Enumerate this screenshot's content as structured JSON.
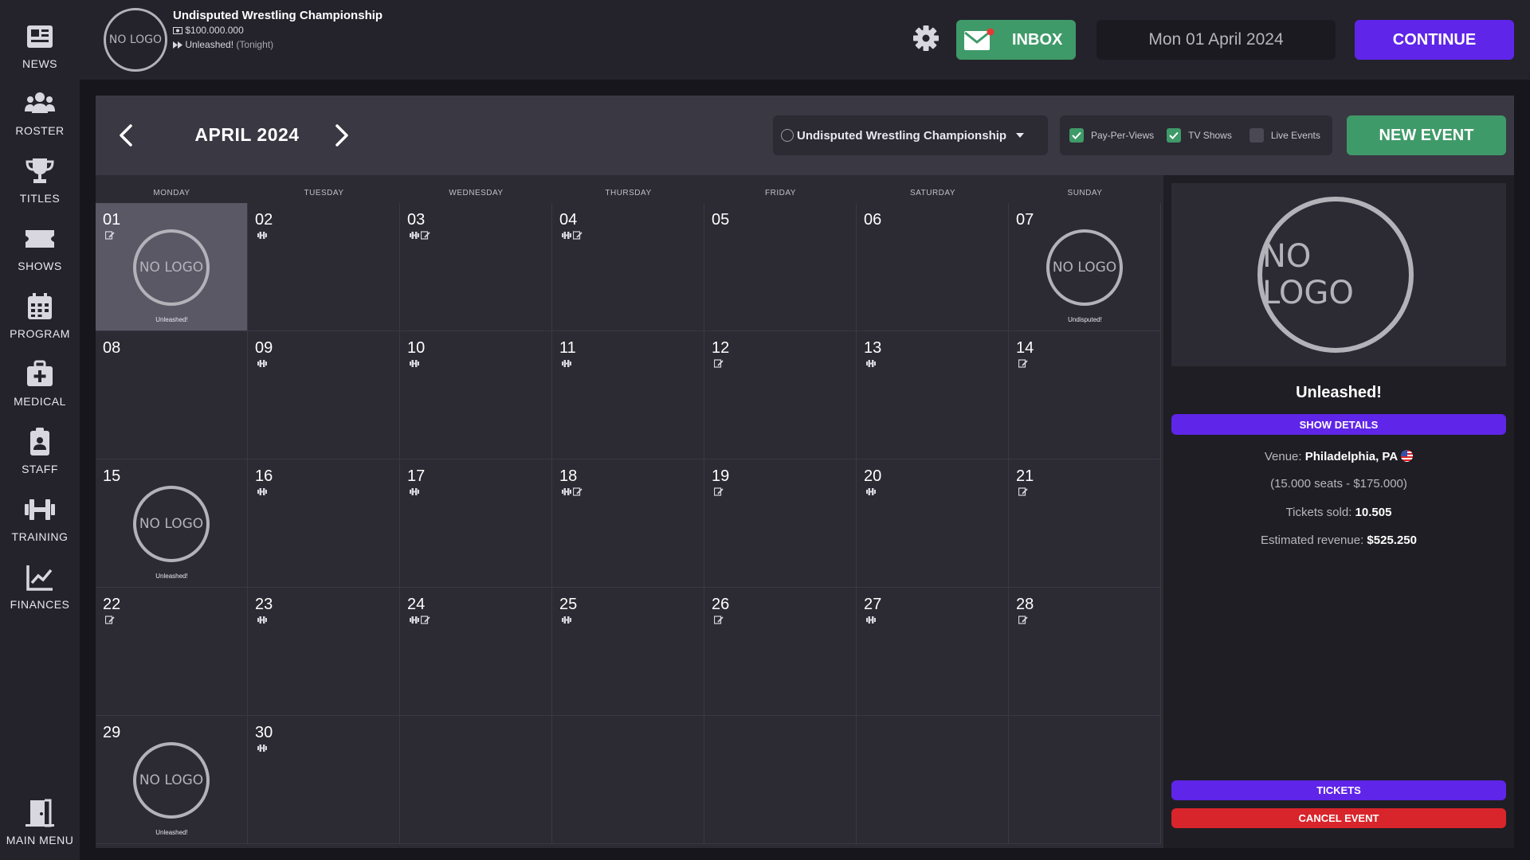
{
  "sidebar": {
    "items": [
      {
        "label": "NEWS",
        "icon": "news-icon"
      },
      {
        "label": "ROSTER",
        "icon": "roster-icon"
      },
      {
        "label": "TITLES",
        "icon": "trophy-icon"
      },
      {
        "label": "SHOWS",
        "icon": "ticket-icon"
      },
      {
        "label": "PROGRAM",
        "icon": "calendar-icon"
      },
      {
        "label": "MEDICAL",
        "icon": "medical-icon"
      },
      {
        "label": "STAFF",
        "icon": "staff-icon"
      },
      {
        "label": "TRAINING",
        "icon": "dumbbell-icon"
      },
      {
        "label": "FINANCES",
        "icon": "chart-icon"
      }
    ],
    "main_menu": "MAIN MENU"
  },
  "topbar": {
    "logo_text": "NO LOGO",
    "promotion_name": "Undisputed Wrestling Championship",
    "balance": "$100.000.000",
    "next_show": "Unleashed!",
    "next_show_when": "(Tonight)",
    "inbox_label": "INBOX",
    "date": "Mon 01 April 2024",
    "continue_label": "CONTINUE"
  },
  "calendar_header": {
    "month": "APRIL 2024",
    "promotion_filter": "Undisputed Wrestling Championship",
    "filters": [
      {
        "label": "Pay-Per-Views",
        "checked": true
      },
      {
        "label": "TV Shows",
        "checked": true
      },
      {
        "label": "Live Events",
        "checked": false
      }
    ],
    "new_event_label": "NEW EVENT"
  },
  "weekdays": [
    "MONDAY",
    "TUESDAY",
    "WEDNESDAY",
    "THURSDAY",
    "FRIDAY",
    "SATURDAY",
    "SUNDAY"
  ],
  "days": [
    {
      "num": "01",
      "icons": [
        "note"
      ],
      "show": "Unleashed!",
      "logo": "NO LOGO",
      "selected": true
    },
    {
      "num": "02",
      "icons": [
        "dumbbell"
      ]
    },
    {
      "num": "03",
      "icons": [
        "dumbbell",
        "note"
      ]
    },
    {
      "num": "04",
      "icons": [
        "dumbbell",
        "note"
      ]
    },
    {
      "num": "05",
      "icons": []
    },
    {
      "num": "06",
      "icons": []
    },
    {
      "num": "07",
      "icons": [],
      "show": "Undisputed!",
      "logo": "NO LOGO"
    },
    {
      "num": "08",
      "icons": []
    },
    {
      "num": "09",
      "icons": [
        "dumbbell"
      ]
    },
    {
      "num": "10",
      "icons": [
        "dumbbell"
      ]
    },
    {
      "num": "11",
      "icons": [
        "dumbbell"
      ]
    },
    {
      "num": "12",
      "icons": [
        "note"
      ]
    },
    {
      "num": "13",
      "icons": [
        "dumbbell"
      ]
    },
    {
      "num": "14",
      "icons": [
        "note"
      ]
    },
    {
      "num": "15",
      "icons": [],
      "show": "Unleashed!",
      "logo": "NO LOGO"
    },
    {
      "num": "16",
      "icons": [
        "dumbbell"
      ]
    },
    {
      "num": "17",
      "icons": [
        "dumbbell"
      ]
    },
    {
      "num": "18",
      "icons": [
        "dumbbell",
        "note"
      ]
    },
    {
      "num": "19",
      "icons": [
        "note"
      ]
    },
    {
      "num": "20",
      "icons": [
        "dumbbell"
      ]
    },
    {
      "num": "21",
      "icons": [
        "note"
      ]
    },
    {
      "num": "22",
      "icons": [
        "note"
      ]
    },
    {
      "num": "23",
      "icons": [
        "dumbbell"
      ]
    },
    {
      "num": "24",
      "icons": [
        "dumbbell",
        "note"
      ]
    },
    {
      "num": "25",
      "icons": [
        "dumbbell"
      ]
    },
    {
      "num": "26",
      "icons": [
        "note"
      ]
    },
    {
      "num": "27",
      "icons": [
        "dumbbell"
      ]
    },
    {
      "num": "28",
      "icons": [
        "note"
      ]
    },
    {
      "num": "29",
      "icons": [],
      "show": "Unleashed!",
      "logo": "NO LOGO"
    },
    {
      "num": "30",
      "icons": [
        "dumbbell"
      ]
    },
    {
      "num": "",
      "icons": []
    },
    {
      "num": "",
      "icons": []
    },
    {
      "num": "",
      "icons": []
    },
    {
      "num": "",
      "icons": []
    },
    {
      "num": "",
      "icons": []
    }
  ],
  "detail": {
    "logo_text": "NO LOGO",
    "title": "Unleashed!",
    "show_details_label": "SHOW DETAILS",
    "venue_label": "Venue:",
    "venue": "Philadelphia, PA",
    "capacity": "(15.000 seats - $175.000)",
    "tickets_label": "Tickets sold:",
    "tickets_sold": "10.505",
    "revenue_label": "Estimated revenue:",
    "revenue": "$525.250",
    "tickets_button": "TICKETS",
    "cancel_button": "CANCEL EVENT"
  },
  "colors": {
    "accent_purple": "#5f25e8",
    "accent_green": "#3f9a69",
    "danger_red": "#d8252b"
  }
}
